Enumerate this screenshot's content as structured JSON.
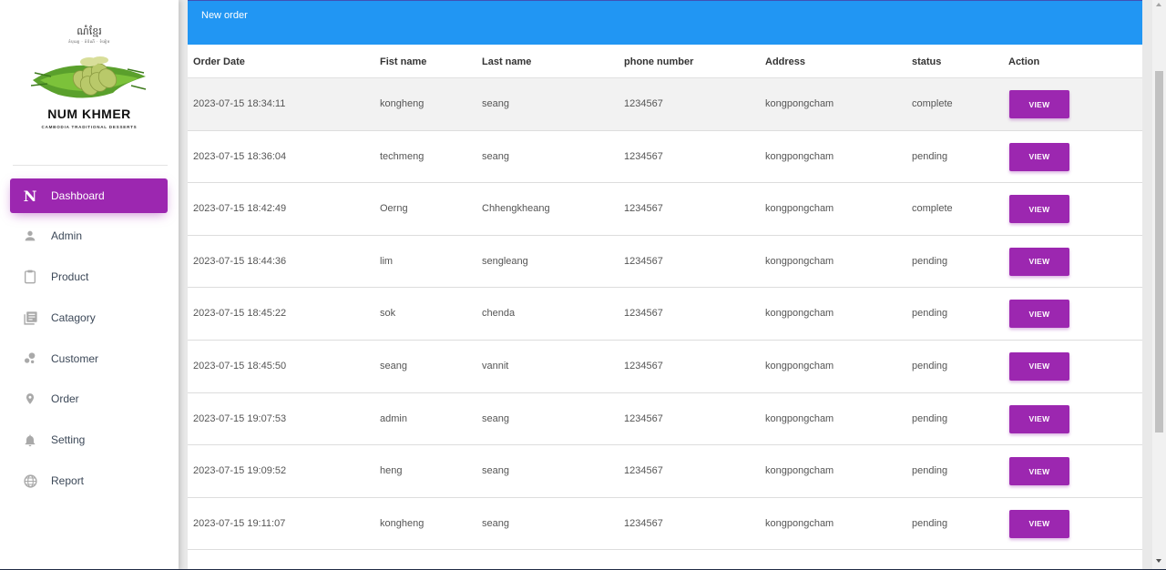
{
  "brand": {
    "khmer_title": "ណំខ្មែរ",
    "khmer_subtitle": "នំបុណ្យ · នំចំណី · ទំនៀម",
    "name": "NUM KHMER",
    "tagline": "CAMBODIA TRADITIONAL DESSERTS"
  },
  "sidebar": {
    "items": [
      {
        "label": "Dashboard",
        "icon": "letter-n-icon",
        "letter": "N",
        "active": true
      },
      {
        "label": "Admin",
        "icon": "person-icon"
      },
      {
        "label": "Product",
        "icon": "clipboard-icon"
      },
      {
        "label": "Catagory",
        "icon": "library-books-icon"
      },
      {
        "label": "Customer",
        "icon": "bubble-chart-icon"
      },
      {
        "label": "Order",
        "icon": "location-pin-icon"
      },
      {
        "label": "Setting",
        "icon": "bell-icon"
      },
      {
        "label": "Report",
        "icon": "globe-icon"
      }
    ]
  },
  "card": {
    "title": "New order"
  },
  "table": {
    "headers": [
      "Order Date",
      "Fist name",
      "Last name",
      "phone number",
      "Address",
      "status",
      "Action"
    ],
    "rows": [
      {
        "date": "2023-07-15 18:34:11",
        "first": "kongheng",
        "last": "seang",
        "phone": "1234567",
        "address": "kongpongcham",
        "status": "complete",
        "action": "VIEW"
      },
      {
        "date": "2023-07-15 18:36:04",
        "first": "techmeng",
        "last": "seang",
        "phone": "1234567",
        "address": "kongpongcham",
        "status": "pending",
        "action": "VIEW"
      },
      {
        "date": "2023-07-15 18:42:49",
        "first": "Oerng",
        "last": "Chhengkheang",
        "phone": "1234567",
        "address": "kongpongcham",
        "status": "complete",
        "action": "VIEW"
      },
      {
        "date": "2023-07-15 18:44:36",
        "first": "lim",
        "last": "sengleang",
        "phone": "1234567",
        "address": "kongpongcham",
        "status": "pending",
        "action": "VIEW"
      },
      {
        "date": "2023-07-15 18:45:22",
        "first": "sok",
        "last": "chenda",
        "phone": "1234567",
        "address": "kongpongcham",
        "status": "pending",
        "action": "VIEW"
      },
      {
        "date": "2023-07-15 18:45:50",
        "first": "seang",
        "last": "vannit",
        "phone": "1234567",
        "address": "kongpongcham",
        "status": "pending",
        "action": "VIEW"
      },
      {
        "date": "2023-07-15 19:07:53",
        "first": "admin",
        "last": "seang",
        "phone": "1234567",
        "address": "kongpongcham",
        "status": "pending",
        "action": "VIEW"
      },
      {
        "date": "2023-07-15 19:09:52",
        "first": "heng",
        "last": "seang",
        "phone": "1234567",
        "address": "kongpongcham",
        "status": "pending",
        "action": "VIEW"
      },
      {
        "date": "2023-07-15 19:11:07",
        "first": "kongheng",
        "last": "seang",
        "phone": "1234567",
        "address": "kongpongcham",
        "status": "pending",
        "action": "VIEW"
      }
    ]
  },
  "colors": {
    "accent_purple": "#9c27b0",
    "header_blue": "#2196f3"
  }
}
